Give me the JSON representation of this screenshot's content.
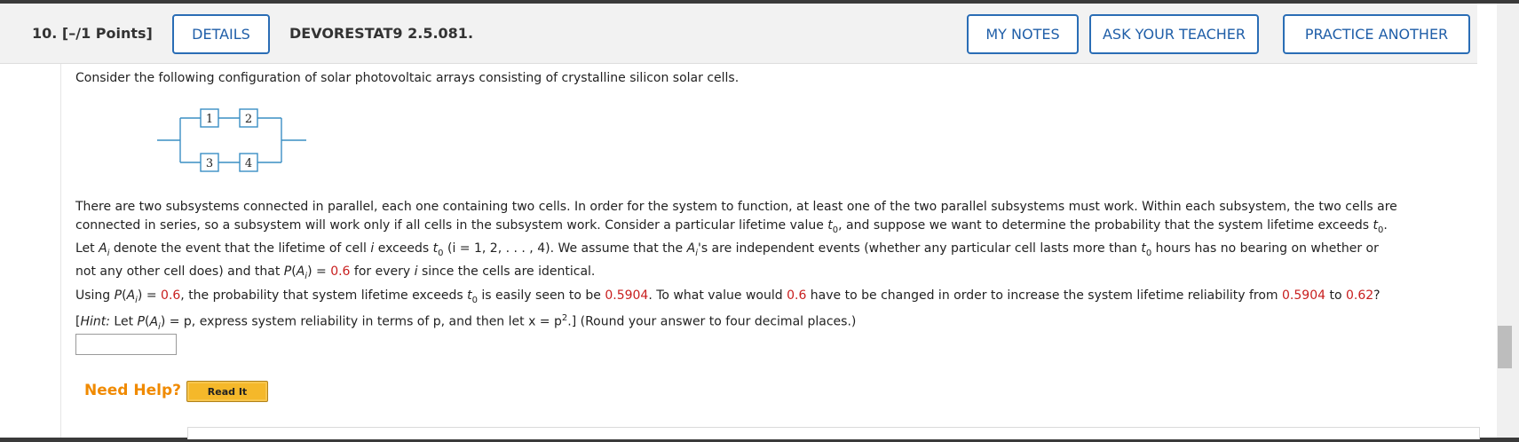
{
  "header": {
    "question_number": "10.",
    "points": "[–/1 Points]",
    "details_label": "DETAILS",
    "question_code": "DEVORESTAT9 2.5.081.",
    "my_notes_label": "MY NOTES",
    "ask_teacher_label": "ASK YOUR TEACHER",
    "practice_another_label": "PRACTICE ANOTHER"
  },
  "intro": "Consider the following configuration of solar photovoltaic arrays consisting of crystalline silicon solar cells.",
  "diagram": {
    "cells": [
      "1",
      "2",
      "3",
      "4"
    ]
  },
  "paragraph1": {
    "line1": "There are two subsystems connected in parallel, each one containing two cells. In order for the system to function, at least one of the two parallel subsystems must work. Within each subsystem, the two cells are",
    "line2a": "connected in series, so a subsystem will work only if all cells in the subsystem work. Consider a particular lifetime value ",
    "line2b": ", and suppose we want to determine the probability that the system lifetime exceeds ",
    "line3a": "Let ",
    "line3b": " denote the event that the lifetime of cell ",
    "line3c": " exceeds ",
    "line3d": " (i = 1, 2, . . . , 4). We assume that the ",
    "line3e": "'s are independent events (whether any particular cell lasts more than ",
    "line3f": " hours has no bearing on whether or",
    "line4a": "not any other cell does) and that ",
    "line4b": " = ",
    "line4c": " for every ",
    "line4d": " since the cells are identical."
  },
  "paragraph2": {
    "a": "Using ",
    "b": " = ",
    "c": ", the probability that system lifetime exceeds ",
    "d": " is easily seen to be ",
    "e": ". To what value would ",
    "f": " have to be changed in order to increase the system lifetime reliability from ",
    "g": " to ",
    "h": "?",
    "hint_label": "Hint:",
    "hint_a": " Let ",
    "hint_b": " = p, express system reliability in terms of p, and then let x = p",
    "hint_c": ".] (Round your answer to four decimal places.)"
  },
  "values": {
    "p": "0.6",
    "reliability": "0.5904",
    "target": "0.62"
  },
  "answer": {
    "value": ""
  },
  "help": {
    "label": "Need Help?",
    "read_it_label": "Read It"
  },
  "colors": {
    "button_border": "#2a6db5",
    "highlight": "#c81e1e",
    "help_orange": "#f08a00",
    "read_it_bg": "#f5b82a"
  }
}
